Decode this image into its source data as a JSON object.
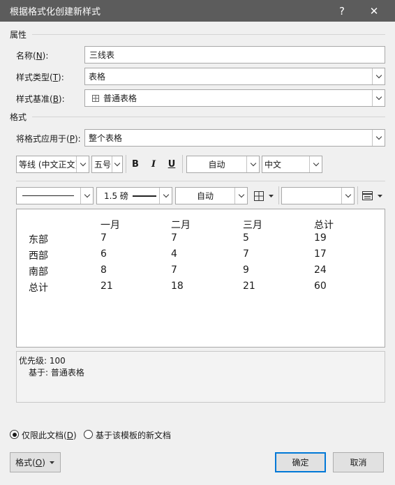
{
  "window": {
    "title": "根据格式化创建新样式",
    "help_label": "?",
    "close_label": "✕"
  },
  "properties": {
    "section_label": "属性",
    "name_label": "名称(N):",
    "name_value": "三线表",
    "style_type_label": "样式类型(T):",
    "style_type_value": "表格",
    "style_based_label": "样式基准(B):",
    "style_based_value": "普通表格",
    "style_based_icon": "table-grid-icon"
  },
  "format": {
    "section_label": "格式",
    "apply_to_label": "将格式应用于(P):",
    "apply_to_value": "整个表格",
    "font_value": "等线 (中文正文)",
    "size_value": "五号",
    "bold_label": "B",
    "italic_label": "I",
    "underline_label": "U",
    "color_value": "自动",
    "language_value": "中文",
    "border_weight_value": "1.5 磅",
    "border_color_value": "自动",
    "shading_value": ""
  },
  "preview": {
    "headers": [
      "",
      "一月",
      "二月",
      "三月",
      "总计"
    ],
    "rows": [
      [
        "东部",
        "7",
        "7",
        "5",
        "19"
      ],
      [
        "西部",
        "6",
        "4",
        "7",
        "17"
      ],
      [
        "南部",
        "8",
        "7",
        "9",
        "24"
      ],
      [
        "总计",
        "21",
        "18",
        "21",
        "60"
      ]
    ]
  },
  "description": {
    "priority": "优先级: 100",
    "based_on": "基于: 普通表格"
  },
  "options": {
    "this_doc_only_label": "仅限此文档(D)",
    "this_doc_only_checked": true,
    "template_label": "基于该模板的新文档",
    "template_checked": false
  },
  "buttons": {
    "format_label": "格式(O)",
    "ok_label": "确定",
    "cancel_label": "取消"
  }
}
